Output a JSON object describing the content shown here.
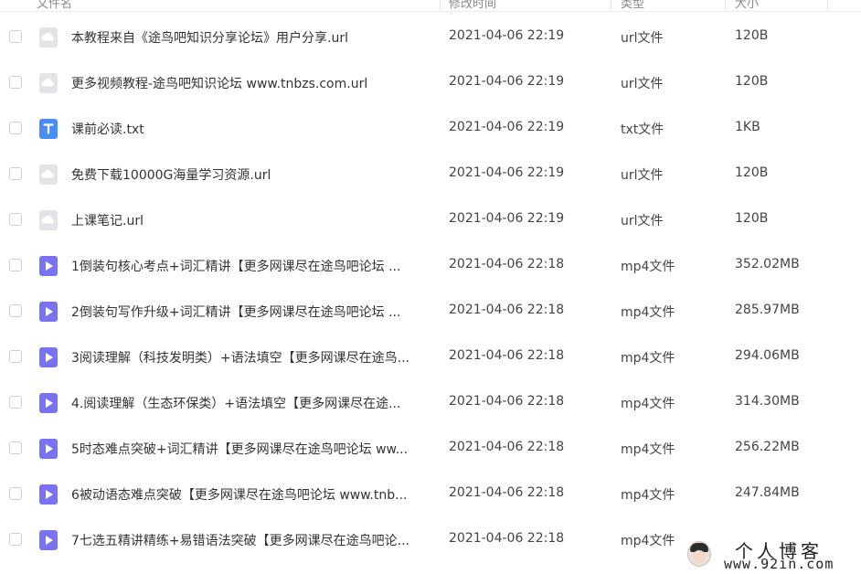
{
  "columns": {
    "name": "文件名",
    "modified": "修改时间",
    "type": "类型",
    "size": "大小"
  },
  "files": [
    {
      "name": "本教程来自《途鸟吧知识分享论坛》用户分享.url",
      "modified": "2021-04-06 22:19",
      "type": "url文件",
      "size": "120B",
      "icon": "url-file-icon"
    },
    {
      "name": "更多视频教程-途鸟吧知识论坛 www.tnbzs.com.url",
      "modified": "2021-04-06 22:19",
      "type": "url文件",
      "size": "120B",
      "icon": "url-file-icon"
    },
    {
      "name": "课前必读.txt",
      "modified": "2021-04-06 22:19",
      "type": "txt文件",
      "size": "1KB",
      "icon": "txt-file-icon"
    },
    {
      "name": "免费下载10000G海量学习资源.url",
      "modified": "2021-04-06 22:19",
      "type": "url文件",
      "size": "120B",
      "icon": "url-file-icon"
    },
    {
      "name": "上课笔记.url",
      "modified": "2021-04-06 22:19",
      "type": "url文件",
      "size": "120B",
      "icon": "url-file-icon"
    },
    {
      "name": "1倒装句核心考点+词汇精讲【更多网课尽在途鸟吧论坛 ...",
      "modified": "2021-04-06 22:18",
      "type": "mp4文件",
      "size": "352.02MB",
      "icon": "video-file-icon"
    },
    {
      "name": "2倒装句写作升级+词汇精讲【更多网课尽在途鸟吧论坛 ...",
      "modified": "2021-04-06 22:18",
      "type": "mp4文件",
      "size": "285.97MB",
      "icon": "video-file-icon"
    },
    {
      "name": "3阅读理解（科技发明类）+语法填空【更多网课尽在途鸟...",
      "modified": "2021-04-06 22:18",
      "type": "mp4文件",
      "size": "294.06MB",
      "icon": "video-file-icon"
    },
    {
      "name": "4.阅读理解（生态环保类）+语法填空【更多网课尽在途...",
      "modified": "2021-04-06 22:18",
      "type": "mp4文件",
      "size": "314.30MB",
      "icon": "video-file-icon"
    },
    {
      "name": "5时态难点突破+词汇精讲【更多网课尽在途鸟吧论坛 ww...",
      "modified": "2021-04-06 22:18",
      "type": "mp4文件",
      "size": "256.22MB",
      "icon": "video-file-icon"
    },
    {
      "name": "6被动语态难点突破【更多网课尽在途鸟吧论坛 www.tnb...",
      "modified": "2021-04-06 22:18",
      "type": "mp4文件",
      "size": "247.84MB",
      "icon": "video-file-icon"
    },
    {
      "name": "7七选五精讲精练+易错语法突破【更多网课尽在途鸟吧论...",
      "modified": "2021-04-06 22:18",
      "type": "mp4文件",
      "size": "",
      "icon": "video-file-icon"
    }
  ],
  "watermark": {
    "title": "个人博客",
    "url": "www.92in.com"
  },
  "colors": {
    "txt_icon": "#4a8cf5",
    "video_icon": "#7a73f1",
    "url_icon": "#e3e4e7"
  }
}
